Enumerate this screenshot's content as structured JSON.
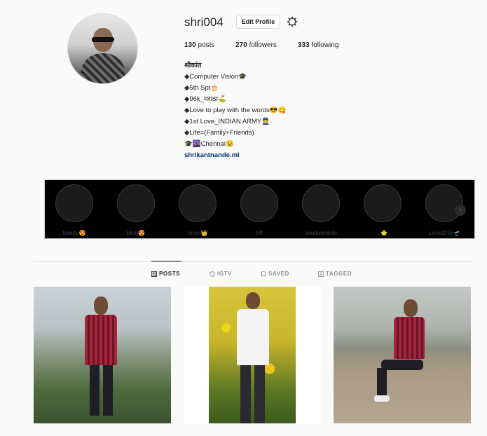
{
  "profile": {
    "username": "shri004",
    "edit_label": "Edit Profile",
    "posts_count": "130",
    "posts_label": "posts",
    "followers_count": "270",
    "followers_label": "followers",
    "following_count": "333",
    "following_label": "following"
  },
  "bio": {
    "name": "श्रीकांत",
    "lines": [
      "◆Computer Vision🎓",
      "◆5th Spt🎂",
      "◆96k_मराठा⛳",
      "◆Love to play with the words😎😋",
      "◆1st Love_INDIAN ARMY👮",
      "◆Life=(Family+Friends)",
      "🎓🌆Chennai😉"
    ],
    "link": "shrikantnande.ml"
  },
  "highlights": [
    {
      "label": "family😍"
    },
    {
      "label": "bhai😍"
    },
    {
      "label": "mom👑"
    },
    {
      "label": "bff"
    },
    {
      "label": "siaskombdii"
    },
    {
      "label": "..🌟"
    },
    {
      "label": "Love2Fly🛫"
    }
  ],
  "tabs": [
    {
      "label": "POSTS",
      "icon": "grid-icon",
      "active": true
    },
    {
      "label": "IGTV",
      "icon": "igtv-icon",
      "active": false
    },
    {
      "label": "SAVED",
      "icon": "bookmark-icon",
      "active": false
    },
    {
      "label": "TAGGED",
      "icon": "tag-icon",
      "active": false
    }
  ],
  "colors": {
    "link": "#00376b",
    "text": "#262626",
    "muted": "#8e8e8e",
    "border": "#dbdbdb",
    "background": "#fafafa"
  }
}
